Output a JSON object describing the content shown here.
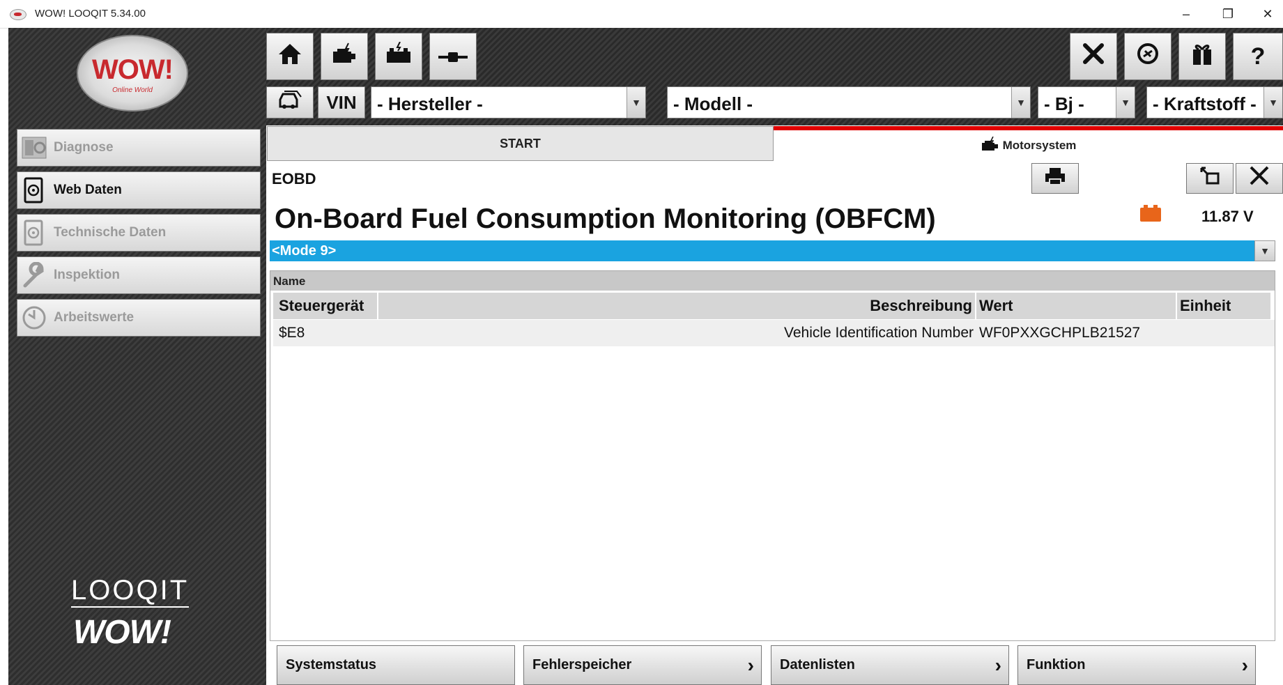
{
  "window": {
    "title": "WOW! LOOQIT 5.34.00",
    "minimize": "–",
    "restore": "❐",
    "close": "✕"
  },
  "brand": {
    "logo_text": "WOW!",
    "logo_sub": "Online World",
    "looqit": "LOOQIT",
    "wow": "WOW!"
  },
  "sidebar": {
    "items": [
      {
        "label": "Diagnose",
        "icon": "diagnose-icon",
        "active": false
      },
      {
        "label": "Web Daten",
        "icon": "tablet-steering-icon",
        "active": true
      },
      {
        "label": "Technische Daten",
        "icon": "tablet-steering-icon",
        "active": false
      },
      {
        "label": "Inspektion",
        "icon": "wrench-icon",
        "active": false
      },
      {
        "label": "Arbeitswerte",
        "icon": "clock-icon",
        "active": false
      }
    ]
  },
  "toolbar": {
    "home": "home-icon",
    "engine": "engine-icon",
    "battery": "battery-icon",
    "connector": "connector-icon",
    "tools": "tools-icon",
    "sync": "sync-icon",
    "gift": "gift-icon",
    "help": "?"
  },
  "selectors": {
    "vin_label": "VIN",
    "manufacturer": "- Hersteller -",
    "model": "- Modell -",
    "year": "- Bj -",
    "fuel": "- Kraftstoff -"
  },
  "tabs": {
    "start": "START",
    "motor": "Motorsystem"
  },
  "content": {
    "section": "EOBD",
    "title": "On-Board Fuel Consumption Monitoring (OBFCM)",
    "voltage": "11.87 V",
    "mode": "<Mode 9>"
  },
  "table": {
    "group_header": "Name",
    "columns": [
      "Steuergerät",
      "Beschreibung",
      "Wert",
      "Einheit"
    ],
    "rows": [
      [
        "$E8",
        "Vehicle Identification Number",
        "WF0PXXGCHPLB21527",
        ""
      ]
    ]
  },
  "bottom_buttons": [
    {
      "label": "Systemstatus",
      "chevron": false
    },
    {
      "label": "Fehlerspeicher",
      "chevron": true
    },
    {
      "label": "Datenlisten",
      "chevron": true
    },
    {
      "label": "Funktion",
      "chevron": true
    }
  ],
  "colors": {
    "accent_blue": "#1aa3e0",
    "tab_red": "#e00000",
    "brand_red": "#c8292e",
    "battery_orange": "#e8651a"
  }
}
